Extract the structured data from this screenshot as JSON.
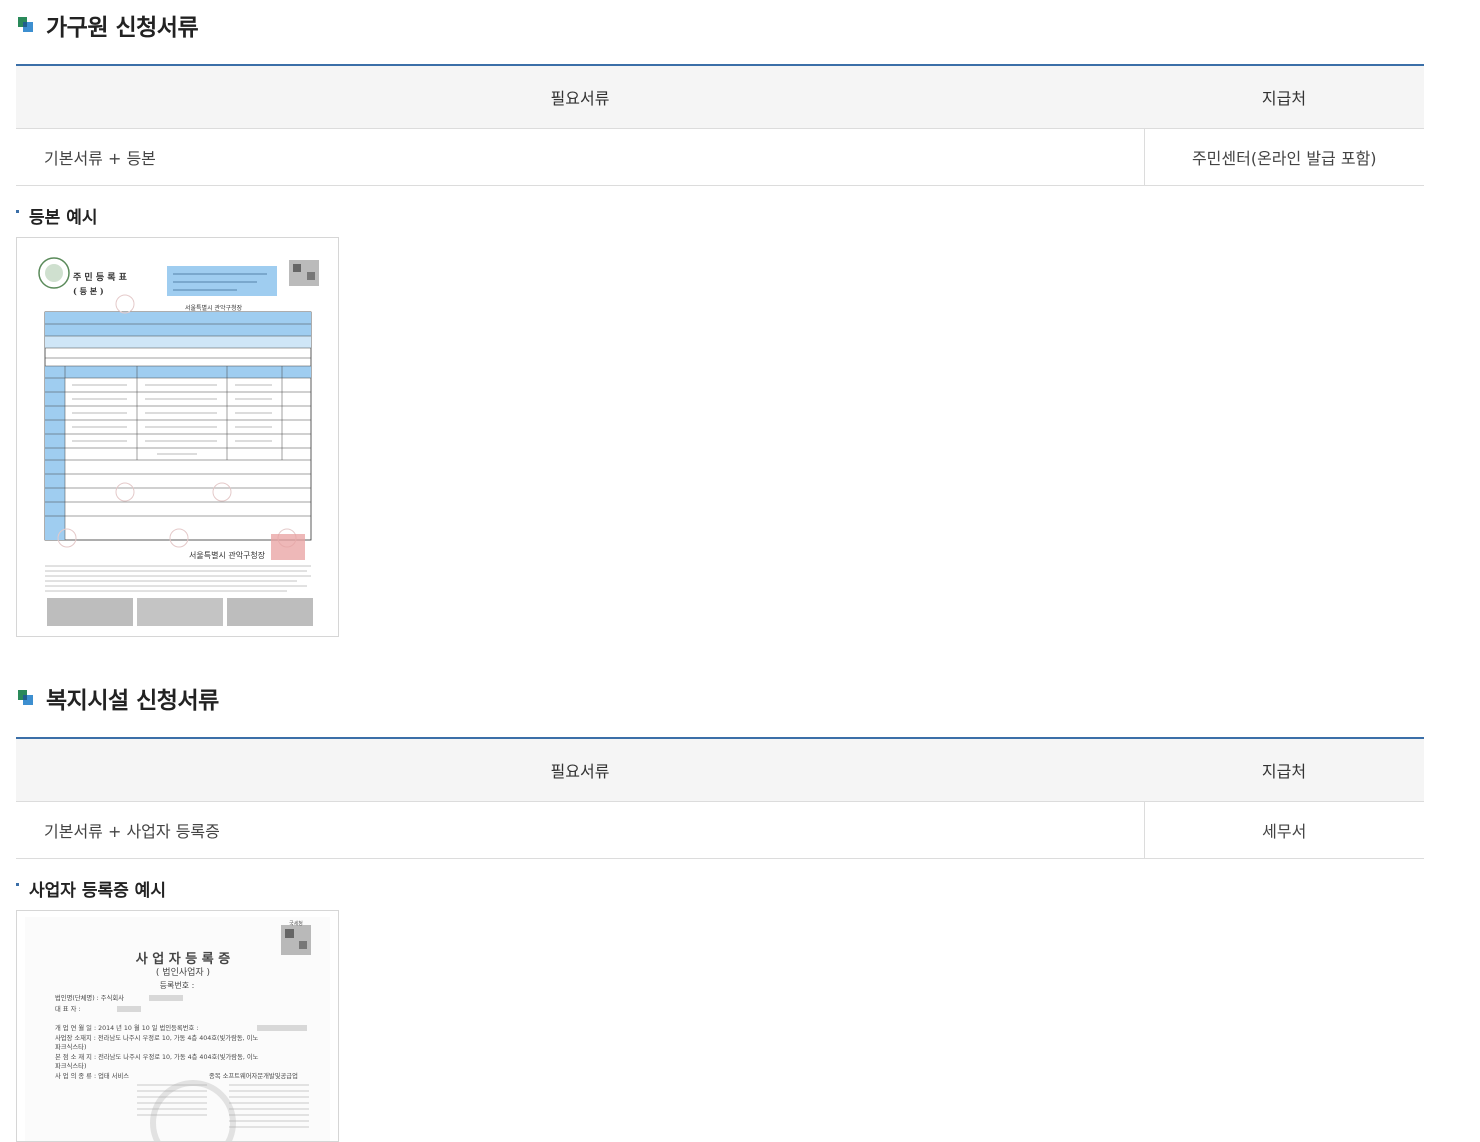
{
  "section1": {
    "title": "가구원 신청서류",
    "table": {
      "col_docs": "필요서류",
      "col_where": "지급처",
      "row_docs": "기본서류 + 등본",
      "row_where": "주민센터(온라인 발급 포함)"
    },
    "example_title": "등본 예시",
    "example_doc": {
      "heading": "주 민 등 록 표",
      "subheading": "( 등    본 )",
      "authority": "서울특별시 관악구청장"
    }
  },
  "section2": {
    "title": "복지시설 신청서류",
    "table": {
      "col_docs": "필요서류",
      "col_where": "지급처",
      "row_docs": "기본서류 + 사업자 등록증",
      "row_where": "세무서"
    },
    "example_title": "사업자 등록증 예시",
    "example_doc": {
      "heading": "사 업 자 등 록 증",
      "subheading": "( 법인사업자 )",
      "reg_no_label": "등록번호 :",
      "rows": [
        "법인명(단체명) : 주식회사",
        "대      표      자 :",
        "개 업 연 월 일 : 2014 년 10 월 10 일     법인등록번호 :",
        "사업장 소재지 : 전라남도 나주시 우정로 10, 가동 4층 404호(빛가람동, 이노",
        "                           파크식스타)",
        "본 점 소 재 지 : 전라남도 나주시 우정로 10, 가동 4층 404호(빛가람동, 이노",
        "                           파크식스타)",
        "사 업 의  종 류 : 업태  서비스",
        "종목  소프트웨어자문개발및공급업"
      ],
      "seal_text": "국세청"
    }
  },
  "colors": {
    "accent": "#3b6fa8",
    "icon_green": "#2a8a5a",
    "icon_blue": "#3d8fd0"
  }
}
